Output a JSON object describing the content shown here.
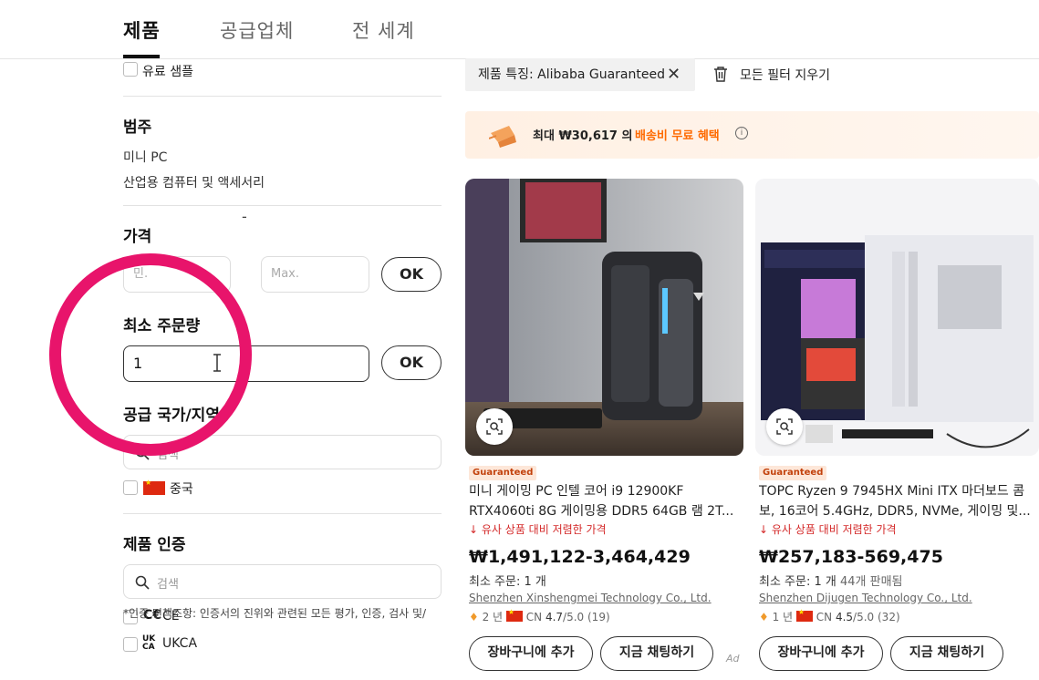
{
  "tabs": [
    {
      "label": "제품",
      "active": true
    },
    {
      "label": "공급업체",
      "active": false
    },
    {
      "label": "전 세계",
      "active": false
    }
  ],
  "sidebar": {
    "paid_sample": "유료 샘플",
    "category": {
      "title": "범주",
      "items": [
        "미니 PC",
        "산업용 컴퓨터 및 액세서리"
      ]
    },
    "price": {
      "title": "가격",
      "min_placeholder": "민.",
      "max_placeholder": "Max.",
      "ok_label": "OK"
    },
    "moq": {
      "title": "최소 주문량",
      "value": "1",
      "ok_label": "OK"
    },
    "supplier_region": {
      "title": "공급 국가/지역",
      "search_placeholder": "검색",
      "countries": [
        {
          "name": "중국"
        }
      ]
    },
    "certification": {
      "title": "제품 인증",
      "search_placeholder": "검색",
      "items": [
        {
          "name": "CE"
        },
        {
          "name": "UKCA"
        }
      ]
    },
    "disclaimer": "*인증 면책조항: 인증서의 진위와 관련된 모든 평가, 인증, 검사 및/"
  },
  "filters": {
    "active_chip": "제품 특징: Alibaba Guaranteed",
    "clear_all": "모든 필터 지우기"
  },
  "promo": {
    "text": "최대 ₩30,617 의",
    "highlight": "배송비 무료 혜택"
  },
  "products": [
    {
      "badge": "Guaranteed",
      "title_line1": "미니 게이밍 PC 인텔 코어 i9 12900KF",
      "title_line2": "RTX4060ti 8G 게이밍용 DDR5 64GB 램 2T...",
      "cheaper": "유사 상품 대비 저렴한 가격",
      "price": "₩1,491,122-3,464,429",
      "moq": "최소 주문: 1 개",
      "sold": "",
      "supplier": "Shenzhen Xinshengmei Technology Co., Ltd.",
      "years": "2 년",
      "country": "CN",
      "rating": "4.7",
      "rating_max": "/5.0",
      "reviews": "(19)",
      "cart_label": "장바구니에 추가",
      "chat_label": "지금 채팅하기"
    },
    {
      "badge": "Guaranteed",
      "title_line1": "TOPC Ryzen 9 7945HX Mini ITX 마더보드 콤",
      "title_line2": "보, 16코어 5.4GHz, DDR5, NVMe, 게이밍 및...",
      "cheaper": "유사 상품 대비 저렴한 가격",
      "price": "₩257,183-569,475",
      "moq": "최소 주문: 1 개",
      "sold": "44개 판매됨",
      "supplier": "Shenzhen Dijugen Technology Co., Ltd.",
      "years": "1 년",
      "country": "CN",
      "rating": "4.5",
      "rating_max": "/5.0",
      "reviews": "(32)",
      "cart_label": "장바구니에 추가",
      "chat_label": "지금 채팅하기"
    }
  ],
  "ad_label": "Ad",
  "colors": {
    "accent": "#ff6a00",
    "highlight_ring": "#e8146b",
    "price_drop": "#d42a2a"
  }
}
